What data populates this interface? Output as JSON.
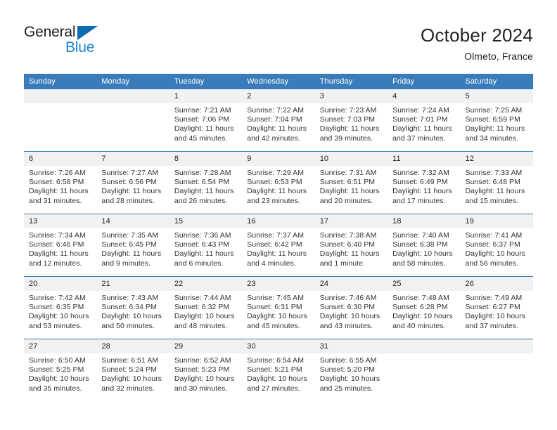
{
  "brand": {
    "name_top": "General",
    "name_bottom": "Blue",
    "triangle_color": "#0d6cb3",
    "blue_text_color": "#1c84d6"
  },
  "header": {
    "title": "October 2024",
    "subtitle": "Olmeto, France"
  },
  "theme": {
    "header_blue": "#3a7cba",
    "daynum_band": "#f1f1f1",
    "text": "#231f20"
  },
  "calendar": {
    "weekday_headers": [
      "Sunday",
      "Monday",
      "Tuesday",
      "Wednesday",
      "Thursday",
      "Friday",
      "Saturday"
    ],
    "weeks": [
      [
        {
          "day": "",
          "sunrise": "",
          "sunset": "",
          "daylight": ""
        },
        {
          "day": "",
          "sunrise": "",
          "sunset": "",
          "daylight": ""
        },
        {
          "day": "1",
          "sunrise": "Sunrise: 7:21 AM",
          "sunset": "Sunset: 7:06 PM",
          "daylight": "Daylight: 11 hours and 45 minutes."
        },
        {
          "day": "2",
          "sunrise": "Sunrise: 7:22 AM",
          "sunset": "Sunset: 7:04 PM",
          "daylight": "Daylight: 11 hours and 42 minutes."
        },
        {
          "day": "3",
          "sunrise": "Sunrise: 7:23 AM",
          "sunset": "Sunset: 7:03 PM",
          "daylight": "Daylight: 11 hours and 39 minutes."
        },
        {
          "day": "4",
          "sunrise": "Sunrise: 7:24 AM",
          "sunset": "Sunset: 7:01 PM",
          "daylight": "Daylight: 11 hours and 37 minutes."
        },
        {
          "day": "5",
          "sunrise": "Sunrise: 7:25 AM",
          "sunset": "Sunset: 6:59 PM",
          "daylight": "Daylight: 11 hours and 34 minutes."
        }
      ],
      [
        {
          "day": "6",
          "sunrise": "Sunrise: 7:26 AM",
          "sunset": "Sunset: 6:58 PM",
          "daylight": "Daylight: 11 hours and 31 minutes."
        },
        {
          "day": "7",
          "sunrise": "Sunrise: 7:27 AM",
          "sunset": "Sunset: 6:56 PM",
          "daylight": "Daylight: 11 hours and 28 minutes."
        },
        {
          "day": "8",
          "sunrise": "Sunrise: 7:28 AM",
          "sunset": "Sunset: 6:54 PM",
          "daylight": "Daylight: 11 hours and 26 minutes."
        },
        {
          "day": "9",
          "sunrise": "Sunrise: 7:29 AM",
          "sunset": "Sunset: 6:53 PM",
          "daylight": "Daylight: 11 hours and 23 minutes."
        },
        {
          "day": "10",
          "sunrise": "Sunrise: 7:31 AM",
          "sunset": "Sunset: 6:51 PM",
          "daylight": "Daylight: 11 hours and 20 minutes."
        },
        {
          "day": "11",
          "sunrise": "Sunrise: 7:32 AM",
          "sunset": "Sunset: 6:49 PM",
          "daylight": "Daylight: 11 hours and 17 minutes."
        },
        {
          "day": "12",
          "sunrise": "Sunrise: 7:33 AM",
          "sunset": "Sunset: 6:48 PM",
          "daylight": "Daylight: 11 hours and 15 minutes."
        }
      ],
      [
        {
          "day": "13",
          "sunrise": "Sunrise: 7:34 AM",
          "sunset": "Sunset: 6:46 PM",
          "daylight": "Daylight: 11 hours and 12 minutes."
        },
        {
          "day": "14",
          "sunrise": "Sunrise: 7:35 AM",
          "sunset": "Sunset: 6:45 PM",
          "daylight": "Daylight: 11 hours and 9 minutes."
        },
        {
          "day": "15",
          "sunrise": "Sunrise: 7:36 AM",
          "sunset": "Sunset: 6:43 PM",
          "daylight": "Daylight: 11 hours and 6 minutes."
        },
        {
          "day": "16",
          "sunrise": "Sunrise: 7:37 AM",
          "sunset": "Sunset: 6:42 PM",
          "daylight": "Daylight: 11 hours and 4 minutes."
        },
        {
          "day": "17",
          "sunrise": "Sunrise: 7:38 AM",
          "sunset": "Sunset: 6:40 PM",
          "daylight": "Daylight: 11 hours and 1 minute."
        },
        {
          "day": "18",
          "sunrise": "Sunrise: 7:40 AM",
          "sunset": "Sunset: 6:38 PM",
          "daylight": "Daylight: 10 hours and 58 minutes."
        },
        {
          "day": "19",
          "sunrise": "Sunrise: 7:41 AM",
          "sunset": "Sunset: 6:37 PM",
          "daylight": "Daylight: 10 hours and 56 minutes."
        }
      ],
      [
        {
          "day": "20",
          "sunrise": "Sunrise: 7:42 AM",
          "sunset": "Sunset: 6:35 PM",
          "daylight": "Daylight: 10 hours and 53 minutes."
        },
        {
          "day": "21",
          "sunrise": "Sunrise: 7:43 AM",
          "sunset": "Sunset: 6:34 PM",
          "daylight": "Daylight: 10 hours and 50 minutes."
        },
        {
          "day": "22",
          "sunrise": "Sunrise: 7:44 AM",
          "sunset": "Sunset: 6:32 PM",
          "daylight": "Daylight: 10 hours and 48 minutes."
        },
        {
          "day": "23",
          "sunrise": "Sunrise: 7:45 AM",
          "sunset": "Sunset: 6:31 PM",
          "daylight": "Daylight: 10 hours and 45 minutes."
        },
        {
          "day": "24",
          "sunrise": "Sunrise: 7:46 AM",
          "sunset": "Sunset: 6:30 PM",
          "daylight": "Daylight: 10 hours and 43 minutes."
        },
        {
          "day": "25",
          "sunrise": "Sunrise: 7:48 AM",
          "sunset": "Sunset: 6:28 PM",
          "daylight": "Daylight: 10 hours and 40 minutes."
        },
        {
          "day": "26",
          "sunrise": "Sunrise: 7:49 AM",
          "sunset": "Sunset: 6:27 PM",
          "daylight": "Daylight: 10 hours and 37 minutes."
        }
      ],
      [
        {
          "day": "27",
          "sunrise": "Sunrise: 6:50 AM",
          "sunset": "Sunset: 5:25 PM",
          "daylight": "Daylight: 10 hours and 35 minutes."
        },
        {
          "day": "28",
          "sunrise": "Sunrise: 6:51 AM",
          "sunset": "Sunset: 5:24 PM",
          "daylight": "Daylight: 10 hours and 32 minutes."
        },
        {
          "day": "29",
          "sunrise": "Sunrise: 6:52 AM",
          "sunset": "Sunset: 5:23 PM",
          "daylight": "Daylight: 10 hours and 30 minutes."
        },
        {
          "day": "30",
          "sunrise": "Sunrise: 6:54 AM",
          "sunset": "Sunset: 5:21 PM",
          "daylight": "Daylight: 10 hours and 27 minutes."
        },
        {
          "day": "31",
          "sunrise": "Sunrise: 6:55 AM",
          "sunset": "Sunset: 5:20 PM",
          "daylight": "Daylight: 10 hours and 25 minutes."
        },
        {
          "day": "",
          "sunrise": "",
          "sunset": "",
          "daylight": ""
        },
        {
          "day": "",
          "sunrise": "",
          "sunset": "",
          "daylight": ""
        }
      ]
    ]
  }
}
